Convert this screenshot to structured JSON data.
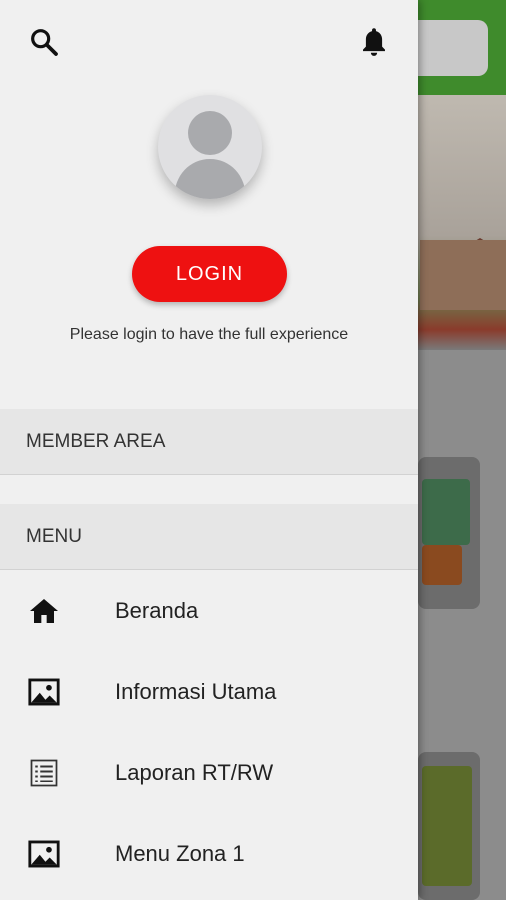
{
  "drawer": {
    "login_label": "LOGIN",
    "login_hint": "Please login to have the full experience",
    "member_area_label": "MEMBER AREA",
    "menu_label": "MENU",
    "menu_items": [
      {
        "label": "Beranda",
        "icon": "home-icon"
      },
      {
        "label": "Informasi Utama",
        "icon": "image-icon"
      },
      {
        "label": "Laporan RT/RW",
        "icon": "list-icon"
      },
      {
        "label": "Menu Zona 1",
        "icon": "image-icon"
      }
    ]
  },
  "colors": {
    "accent": "#ee1111",
    "topbar": "#3f8b2c"
  }
}
